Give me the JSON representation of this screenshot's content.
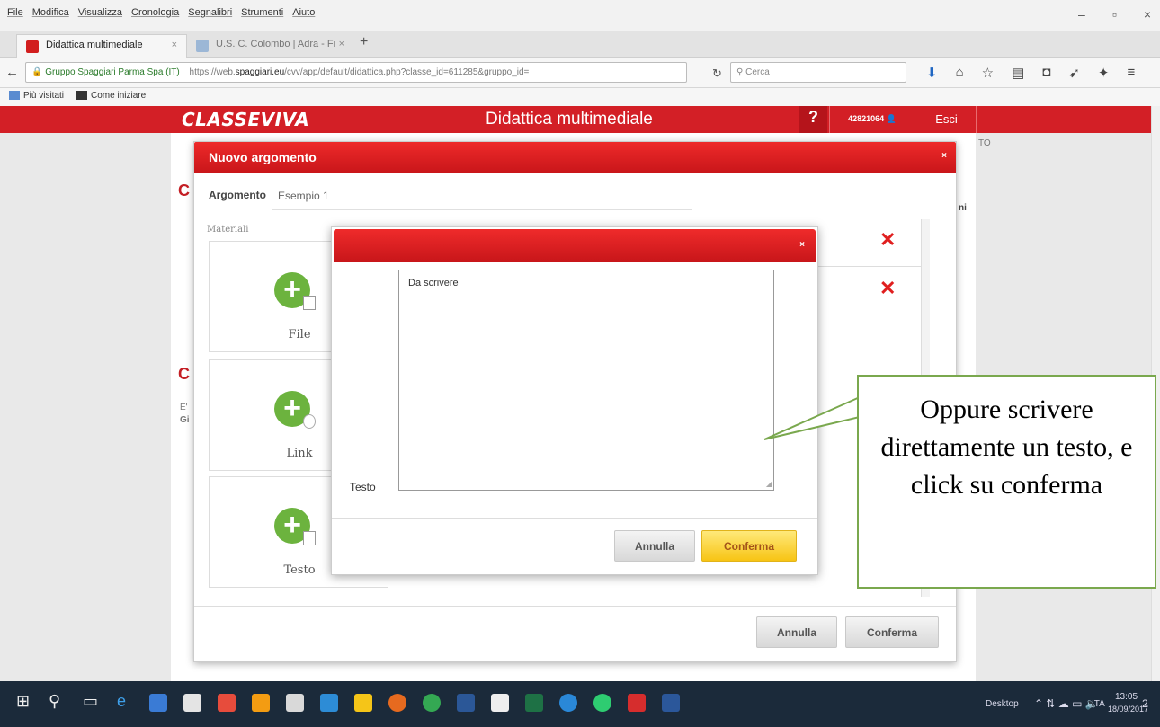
{
  "browser": {
    "menu": [
      "File",
      "Modifica",
      "Visualizza",
      "Cronologia",
      "Segnalibri",
      "Strumenti",
      "Aiuto"
    ],
    "window_controls": [
      "–",
      "▫",
      "×"
    ],
    "tabs": [
      {
        "title": "Didattica multimediale",
        "close": "×"
      },
      {
        "title": "U.S. C. Colombo | Adra - Fi",
        "close": "×"
      }
    ],
    "new_tab": "+",
    "url_identity": "Gruppo Spaggiari Parma Spa (IT)",
    "url_prefix": "https://web.",
    "url_domain": "spaggiari.eu",
    "url_path": "/cvv/app/default/didattica.php?classe_id=611285&gruppo_id=",
    "search_placeholder": "Cerca",
    "bookmarks": [
      "Più visitati",
      "Come iniziare"
    ]
  },
  "header": {
    "brand": "CLASSEVIVA",
    "title": "Didattica multimediale",
    "help": "?",
    "user_code": "42821064",
    "logout": "Esci"
  },
  "background": {
    "c1": "C",
    "c2": "C",
    "side_a": "TO",
    "side_b": "ni",
    "side_c": "E'",
    "side_d": "Gi"
  },
  "modal": {
    "title": "Nuovo argomento",
    "close": "×",
    "argomento_label": "Argomento",
    "argomento_value": "Esempio 1",
    "materiali_label": "Materiali",
    "tiles": [
      {
        "label": "File"
      },
      {
        "label": "Link"
      },
      {
        "label": "Testo"
      }
    ],
    "remove_icon": "✕",
    "cancel": "Annulla",
    "confirm": "Conferma"
  },
  "text_dialog": {
    "close": "×",
    "textarea_value": "Da scrivere",
    "label": "Testo",
    "cancel": "Annulla",
    "confirm": "Conferma"
  },
  "callout": {
    "text": "Oppure scrivere direttamente un testo, e click su conferma"
  },
  "taskbar": {
    "desktop": "Desktop",
    "language": "ITA",
    "time": "13:05",
    "date": "18/09/2017",
    "notif": "2"
  },
  "colors": {
    "brand_red": "#d31f26",
    "confirm_yellow": "#f7c414",
    "plus_green": "#6cb33e",
    "callout_border": "#7aa84e"
  }
}
